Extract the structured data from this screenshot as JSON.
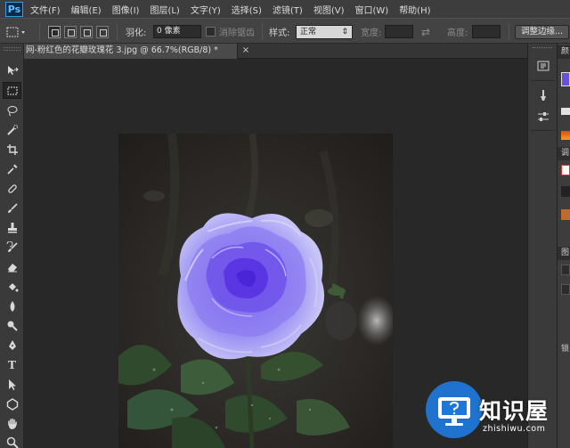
{
  "app": {
    "logo": "Ps",
    "menu": [
      "文件(F)",
      "编辑(E)",
      "图像(I)",
      "图层(L)",
      "文字(Y)",
      "选择(S)",
      "滤镜(T)",
      "视图(V)",
      "窗口(W)",
      "帮助(H)"
    ]
  },
  "options_bar": {
    "feather_label": "羽化:",
    "feather_value": "0 像素",
    "antialias_label": "消除锯齿",
    "style_label": "样式:",
    "style_value": "正常",
    "width_label": "宽度:",
    "height_label": "高度:",
    "refine_edge_button": "调整边缘..."
  },
  "document": {
    "tab_title": "网-粉红色的花瓣玫瑰花 3.jpg @ 66.7%(RGB/8) *",
    "close": "×"
  },
  "tools": [
    "move-tool",
    "rectangular-marquee-tool",
    "lasso-tool",
    "quick-selection-tool",
    "crop-tool",
    "eyedropper-tool",
    "spot-healing-brush-tool",
    "brush-tool",
    "clone-stamp-tool",
    "history-brush-tool",
    "eraser-tool",
    "paint-bucket-tool",
    "blur-tool",
    "dodge-tool",
    "pen-tool",
    "type-tool",
    "path-selection-tool",
    "shape-tool",
    "hand-tool",
    "zoom-tool"
  ],
  "panels": {
    "header_1": "颜",
    "header_2": "调",
    "header_3": "图",
    "header_4": "锁"
  },
  "watermark": {
    "brand": "知识屋",
    "url": "zhishiwu.com"
  },
  "colors": {
    "accent_swatch": "#6b4fd8",
    "rose_main": "#8f86f0",
    "rose_center": "#6a45e6"
  }
}
